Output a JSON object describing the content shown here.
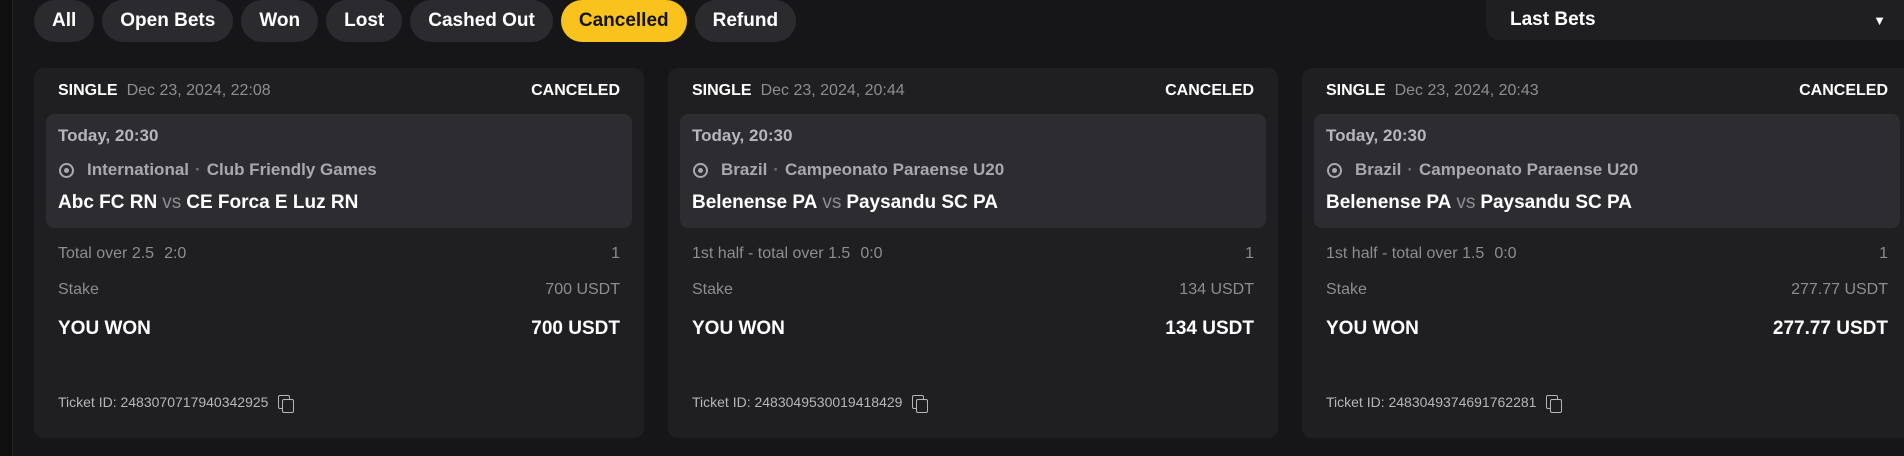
{
  "filters": [
    {
      "label": "All",
      "active": false
    },
    {
      "label": "Open Bets",
      "active": false
    },
    {
      "label": "Won",
      "active": false
    },
    {
      "label": "Lost",
      "active": false
    },
    {
      "label": "Cashed Out",
      "active": false
    },
    {
      "label": "Cancelled",
      "active": true
    },
    {
      "label": "Refund",
      "active": false
    }
  ],
  "dropdown": {
    "selected": "Last Bets",
    "caret_icon": "caret-down-icon"
  },
  "colors": {
    "accent": "#f9c21c",
    "background": "#161618",
    "card": "#1f1f22",
    "event": "#2d2d31"
  },
  "cards": [
    {
      "bet_type": "SINGLE",
      "date": "Dec 23, 2024, 22:08",
      "status": "CANCELED",
      "event_time": "Today, 20:30",
      "country": "International",
      "league": "Club Friendly Games",
      "home": "Abc FC RN",
      "vs": "vs",
      "away": "CE Forca E Luz RN",
      "market": "Total over 2.5",
      "score": "2:0",
      "odds": "1",
      "stake_label": "Stake",
      "stake": "700 USDT",
      "won_label": "YOU WON",
      "won": "700 USDT",
      "ticket": "Ticket ID: 2483070717940342925"
    },
    {
      "bet_type": "SINGLE",
      "date": "Dec 23, 2024, 20:44",
      "status": "CANCELED",
      "event_time": "Today, 20:30",
      "country": "Brazil",
      "league": "Campeonato Paraense U20",
      "home": "Belenense PA",
      "vs": "vs",
      "away": "Paysandu SC PA",
      "market": "1st half - total over 1.5",
      "score": "0:0",
      "odds": "1",
      "stake_label": "Stake",
      "stake": "134 USDT",
      "won_label": "YOU WON",
      "won": "134 USDT",
      "ticket": "Ticket ID: 2483049530019418429"
    },
    {
      "bet_type": "SINGLE",
      "date": "Dec 23, 2024, 20:43",
      "status": "CANCELED",
      "event_time": "Today, 20:30",
      "country": "Brazil",
      "league": "Campeonato Paraense U20",
      "home": "Belenense PA",
      "vs": "vs",
      "away": "Paysandu SC PA",
      "market": "1st half - total over 1.5",
      "score": "0:0",
      "odds": "1",
      "stake_label": "Stake",
      "stake": "277.77 USDT",
      "won_label": "YOU WON",
      "won": "277.77 USDT",
      "ticket": "Ticket ID: 2483049374691762281"
    }
  ]
}
